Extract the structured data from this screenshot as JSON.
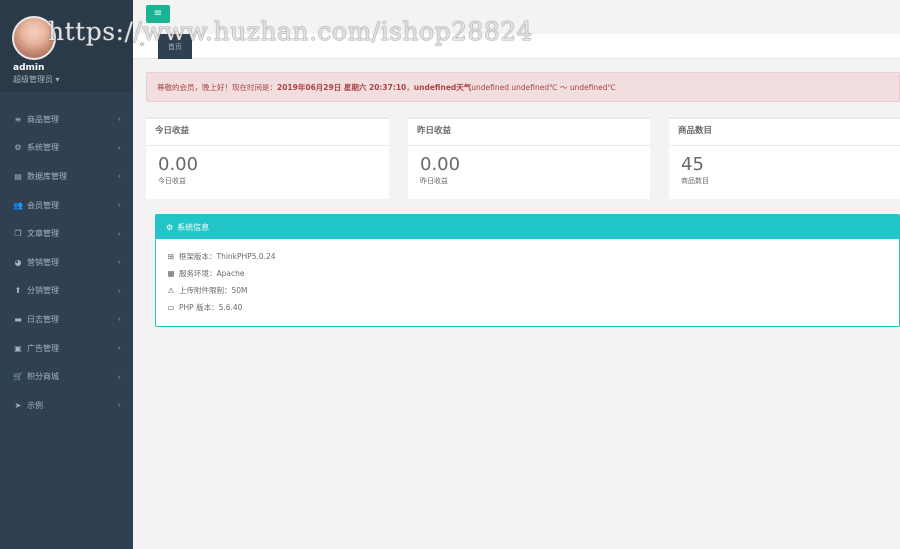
{
  "watermark": "https://www.huzhan.com/ishop28824",
  "profile": {
    "name": "admin",
    "role": "超级管理员 ▾"
  },
  "menu": [
    {
      "label": "商品管理",
      "icon": "≡"
    },
    {
      "label": "系统管理",
      "icon": "⚙"
    },
    {
      "label": "数据库管理",
      "icon": "▤"
    },
    {
      "label": "会员管理",
      "icon": "👥"
    },
    {
      "label": "文章管理",
      "icon": "❐"
    },
    {
      "label": "营销管理",
      "icon": "◕"
    },
    {
      "label": "分销管理",
      "icon": "⬆"
    },
    {
      "label": "日志管理",
      "icon": "▬"
    },
    {
      "label": "广告管理",
      "icon": "▣"
    },
    {
      "label": "积分商城",
      "icon": "🛒"
    },
    {
      "label": "示例",
      "icon": "➤"
    }
  ],
  "menu_arrow": "‹",
  "topbar": {
    "toggle_glyph": "≡"
  },
  "tabs": {
    "back": "«",
    "active": "首页"
  },
  "alert": {
    "greeting": "尊敬的会员，晚上好！现在时间是：",
    "datetime": "2019年06月29日 星期六 20:37:10",
    "sep": "，",
    "weather_bold": "undefined天气",
    "weather_rest": " undefined undefined℃ ～ undefined℃"
  },
  "cards": [
    {
      "title": "今日收益",
      "value": "0.00",
      "label": "今日收益"
    },
    {
      "title": "昨日收益",
      "value": "0.00",
      "label": "昨日收益"
    },
    {
      "title": "商品数目",
      "value": "45",
      "label": "商品数目"
    }
  ],
  "system": {
    "title": "系统信息",
    "items": [
      {
        "icon": "⊞",
        "text": "框架版本：ThinkPHP5.0.24"
      },
      {
        "icon": "▦",
        "text": "服务环境：Apache"
      },
      {
        "icon": "⚠",
        "text": "上传附件限制：50M"
      },
      {
        "icon": "▭",
        "text": "PHP 版本：5.6.40"
      }
    ]
  },
  "colors": {
    "sidebar": "#2f4050",
    "primary": "#1ab394",
    "info": "#23c6c8",
    "alert_bg": "#f2dede",
    "alert_text": "#a94442"
  }
}
